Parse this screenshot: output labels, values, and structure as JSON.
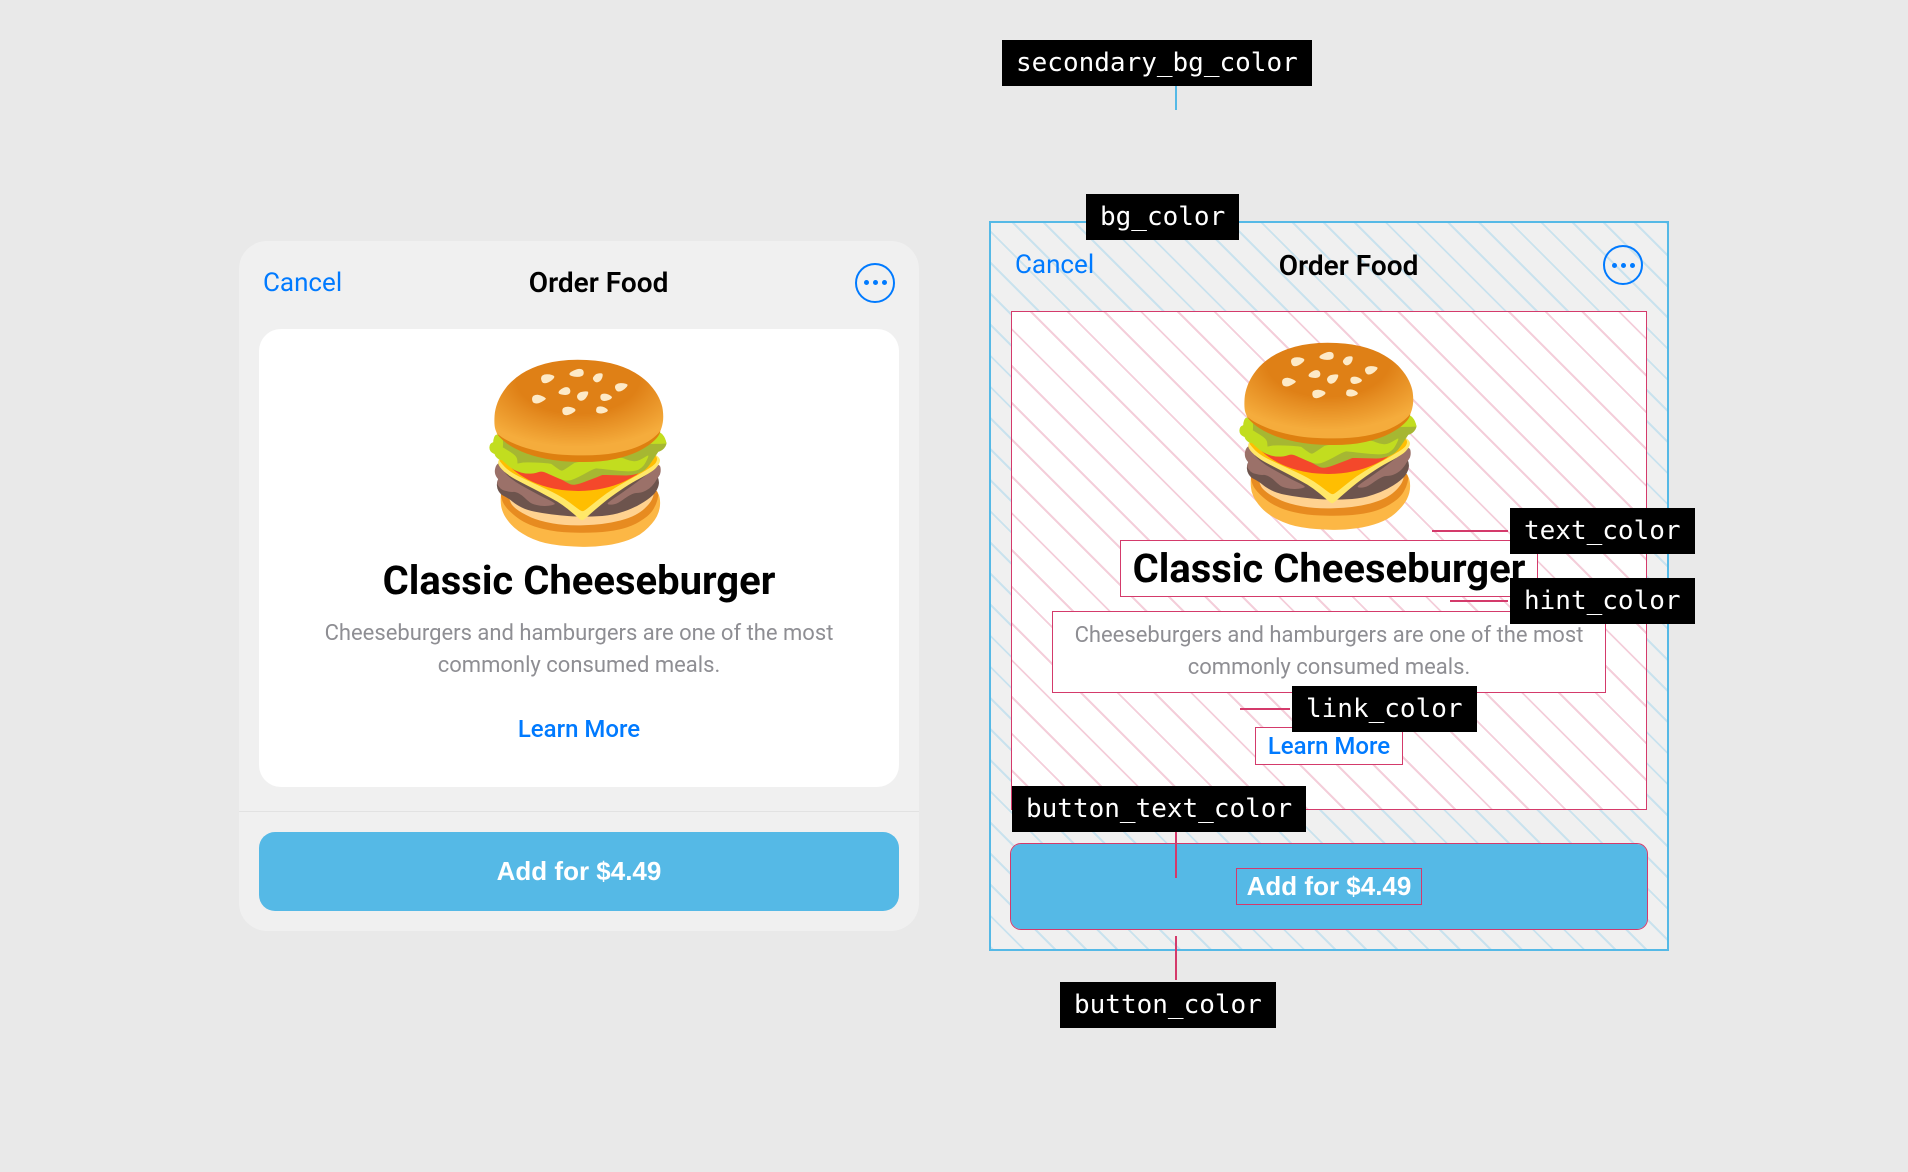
{
  "header": {
    "cancel_label": "Cancel",
    "title": "Order Food",
    "more_icon_name": "more-icon"
  },
  "product": {
    "emoji": "🍔",
    "title": "Classic Cheeseburger",
    "description": "Cheeseburgers and hamburgers are one of the most commonly consumed meals.",
    "learn_more_label": "Learn More"
  },
  "cta": {
    "label": "Add for $4.49"
  },
  "annotations": {
    "secondary_bg": "secondary_bg_color",
    "bg": "bg_color",
    "text": "text_color",
    "hint": "hint_color",
    "link": "link_color",
    "button_text": "button_text_color",
    "button": "button_color"
  },
  "colors": {
    "secondary_bg_color": "#f0f0f0",
    "bg_color": "#ffffff",
    "text_color": "#000000",
    "hint_color": "#8e8e93",
    "link_color": "#007aff",
    "button_color": "#55b9e6",
    "button_text_color": "#ffffff"
  }
}
